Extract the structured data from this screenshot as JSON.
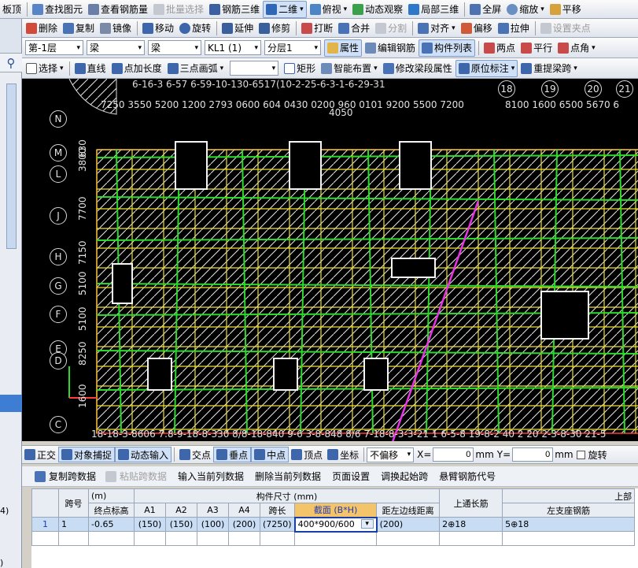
{
  "toolbar1": {
    "items": [
      "板顶",
      "查找图元",
      "查看钢筋量",
      "批量选择",
      "钢筋三维",
      "二维",
      "俯视",
      "动态观察",
      "局部三维",
      "全屏",
      "缩放",
      "平移"
    ],
    "disabled": [
      "批量选择"
    ]
  },
  "toolbar2": {
    "items": [
      "删除",
      "复制",
      "镜像",
      "移动",
      "旋转",
      "延伸",
      "修剪",
      "打断",
      "合并",
      "分割",
      "对齐",
      "偏移",
      "拉伸",
      "设置夹点"
    ],
    "disabled": [
      "分割",
      "设置夹点"
    ]
  },
  "toolbar3": {
    "floor": "第-1层",
    "type": "梁",
    "subtype": "梁",
    "element": "KL1 (1)",
    "layer": "分层1",
    "props_btn": "属性",
    "edit_rebar_btn": "编辑钢筋",
    "component_list_btn": "构件列表",
    "two_point": "两点",
    "parallel": "平行",
    "point_angle": "点角"
  },
  "toolbar4": {
    "items": [
      "选择",
      "直线",
      "点加长度",
      "三点画弧",
      "矩形",
      "智能布置",
      "修改梁段属性",
      "原位标注",
      "重提梁跨"
    ]
  },
  "left_panel": {
    "lines": [
      "4)",
      ")"
    ]
  },
  "canvas": {
    "axes_left": [
      "N",
      "M",
      "L",
      "J",
      "H",
      "G",
      "F",
      "E",
      "D",
      "C"
    ],
    "dims_left": [
      "630",
      "3800",
      "7700",
      "7150",
      "5100",
      "5100",
      "8250",
      "1600"
    ],
    "top_axis_text": "6-16-3  6-57  6-59-10-130-6517(10-2-25-6-3-1-6-29-31",
    "top_axis_nums": [
      "18",
      "19",
      "20",
      "21"
    ],
    "top_dims": "7250 3550 5200 1200 2793 0600 604 0430 0200 960 0101 9200 5500 7200",
    "top_dims_right": "8100 1600 6500  5670  6",
    "top_center_dim": "4050",
    "bottom_axis_text": "18-18-3-8606 7.8-9-18-8-330 8/8-18-840 9-6 3-8-848 8/6 7-18-8-3-3-21 1 6-5-8 19-8-2 40 2 20 2-3-8-30 21-5"
  },
  "snapbar": {
    "items": [
      "正交",
      "对象捕捉",
      "动态输入",
      "交点",
      "垂点",
      "中点",
      "顶点",
      "坐标"
    ],
    "offset_mode": "不偏移",
    "x_label": "X=",
    "x_value": "0",
    "y_label": "Y=",
    "y_value": "0",
    "unit": "mm",
    "rotate_label": "旋转"
  },
  "panel_toolbar": {
    "items": [
      "复制跨数据",
      "粘贴跨数据",
      "输入当前列数据",
      "删除当前列数据",
      "页面设置",
      "调换起始跨",
      "悬臂钢筋代号"
    ],
    "disabled": [
      "粘贴跨数据"
    ]
  },
  "grid": {
    "h_span": "跨号",
    "h_elev": "(m)",
    "h_elev_sub": "终点标高",
    "h_size": "构件尺寸 (mm)",
    "h_top_bar": "上通长筋",
    "h_upper": "上部",
    "h_left_seat": "左支座钢筋",
    "cols": [
      "A1",
      "A2",
      "A3",
      "A4",
      "跨长",
      "截面 (B*H)",
      "距左边线距离"
    ],
    "rows": [
      {
        "idx": "1",
        "span": "1",
        "elev": "-0.65",
        "a1": "(150)",
        "a2": "(150)",
        "a3": "(100)",
        "a4": "(200)",
        "len": "(7250)",
        "section": "400*900/600",
        "dist": "(200)",
        "top": "2⊕18",
        "left_seat": "5⊕18"
      }
    ]
  }
}
